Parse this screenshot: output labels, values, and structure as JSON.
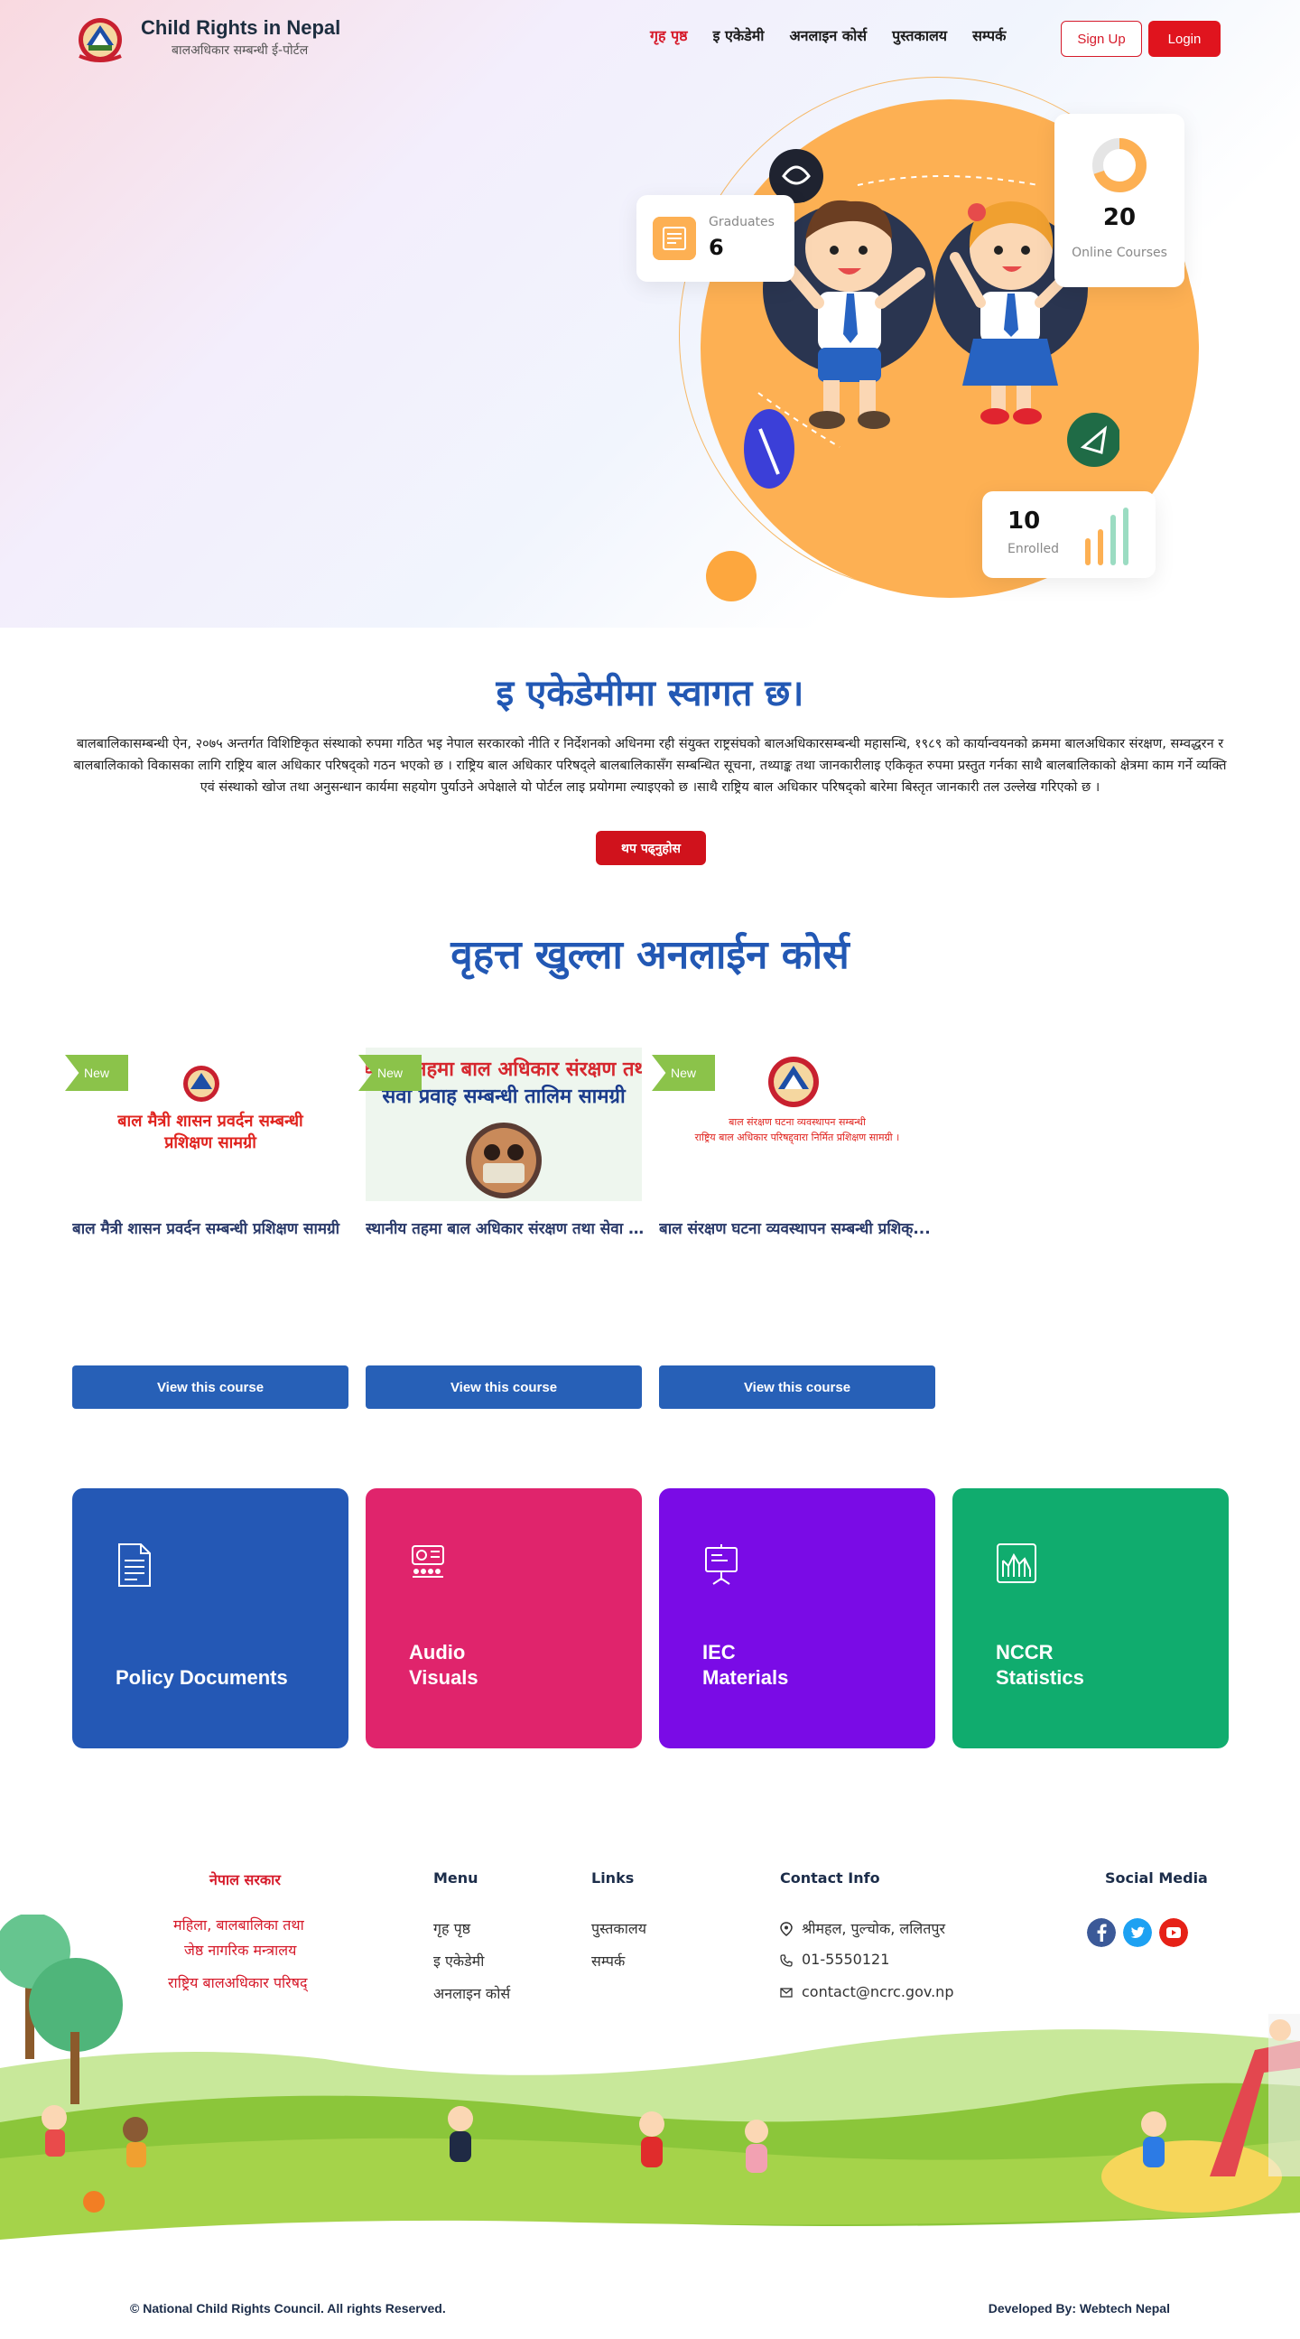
{
  "brand": {
    "title": "Child Rights in Nepal",
    "subtitle": "बालअधिकार सम्बन्धी ई-पोर्टल"
  },
  "nav": {
    "items": [
      "गृह पृष्ठ",
      "इ एकेडेमी",
      "अनलाइन कोर्स",
      "पुस्तकालय",
      "सम्पर्क"
    ],
    "active": 0,
    "signup": "Sign Up",
    "login": "Login"
  },
  "hero": {
    "graduates": {
      "label": "Graduates",
      "value": "6"
    },
    "online_courses": {
      "label": "Online Courses",
      "value": "20"
    },
    "enrolled": {
      "label": "Enrolled",
      "value": "10"
    },
    "colors": {
      "accent": "#fdb053",
      "red": "#e0141e"
    }
  },
  "welcome": {
    "title": "इ एकेडेमीमा स्वागत छ।",
    "text": "बालबालिकासम्बन्धी ऐन, २०७५ अन्तर्गत विशिष्टिकृत संस्थाको रुपमा गठित भइ नेपाल सरकारको नीति र निर्देशनको अधिनमा रही संयुक्त राष्ट्रसंघको बालअधिकारसम्बन्धी महासन्धि, १९८९ को कार्यान्वयनको क्रममा बालअधिकार संरक्षण, सम्वद्धरन र बालबालिकाको विकासका लागि राष्ट्रिय बाल अधिकार परिषद्को गठन भएको छ । राष्ट्रिय बाल अधिकार परिषद्ले बालबालिकासँग सम्बन्धित सूचना, तथ्याङ्क तथा जानकारीलाइ एकिकृत रुपमा प्रस्तुत गर्नका साथै बालबालिकाको क्षेत्रमा काम गर्ने व्यक्ति एवं संस्थाको खोज तथा अनुसन्धान कार्यमा सहयोग पुर्याउने अपेक्षाले यो पोर्टल लाइ प्रयोगमा ल्याइएको छ ।साथै राष्ट्रिय बाल अधिकार परिषद्को बारेमा बिस्तृत जानकारी तल उल्लेख गरिएको छ ।",
    "button": "थप पढ्नुहोस"
  },
  "courses": {
    "title": "वृहत्त खुल्ला अनलाईन कोर्स",
    "items": [
      {
        "badge": "New",
        "thumb_lines": [
          "बाल मैत्री शासन प्रवर्दन सम्बन्धी",
          "प्रशिक्षण सामग्री"
        ],
        "title": "बाल मैत्री शासन प्रवर्दन सम्बन्धी प्रशिक्षण सामग्री",
        "button": "View this course"
      },
      {
        "badge": "New",
        "thumb_lines": [
          "स्थानीय तहमा बाल अधिकार संरक्षण तथा",
          "सेवा प्रवाह सम्बन्धी तालिम सामग्री"
        ],
        "title": "स्थानीय तहमा बाल अधिकार संरक्षण तथा सेवा ...",
        "button": "View this course"
      },
      {
        "badge": "New",
        "thumb_lines": [
          "बाल संरक्षण घटना व्यवस्थापन सम्बन्धी",
          "राष्ट्रिय बाल अधिकार परिषद्द्वारा निर्मित प्रशिक्षण सामग्री ।"
        ],
        "title": "बाल संरक्षण घटना व्यवस्थापन सम्बन्धी प्रशिक्...",
        "button": "View this course"
      }
    ]
  },
  "categories": [
    {
      "label": "Policy Documents",
      "color": "#2458b5",
      "icon": "document-icon"
    },
    {
      "label": "Audio\nVisuals",
      "color": "#e0246c",
      "icon": "projector-icon"
    },
    {
      "label": "IEC\nMaterials",
      "color": "#7a0be6",
      "icon": "presentation-board-icon"
    },
    {
      "label": "NCCR\nStatistics",
      "color": "#10ac6e",
      "icon": "chart-icon"
    }
  ],
  "footer": {
    "gov": {
      "title": "नेपाल सरकार",
      "ministry_1": "महिला, बालबालिका तथा",
      "ministry_2": "जेष्ठ नागरिक मन्त्रालय",
      "council": "राष्ट्रिय बालअधिकार परिषद्"
    },
    "menu": {
      "title": "Menu",
      "items": [
        "गृह पृष्ठ",
        "इ एकेडेमी",
        "अनलाइन कोर्स"
      ]
    },
    "links": {
      "title": "Links",
      "items": [
        "पुस्तकालय",
        "सम्पर्क"
      ]
    },
    "contact": {
      "title": "Contact Info",
      "address": "श्रीमहल, पुल्चोक, ललितपुर",
      "phone": "01-5550121",
      "email": "contact@ncrc.gov.np"
    },
    "social": {
      "title": "Social Media",
      "items": [
        "facebook-icon",
        "twitter-icon",
        "youtube-icon"
      ]
    },
    "copyright": "© National Child Rights Council. All rights Reserved.",
    "developer": "Developed By: Webtech Nepal"
  }
}
